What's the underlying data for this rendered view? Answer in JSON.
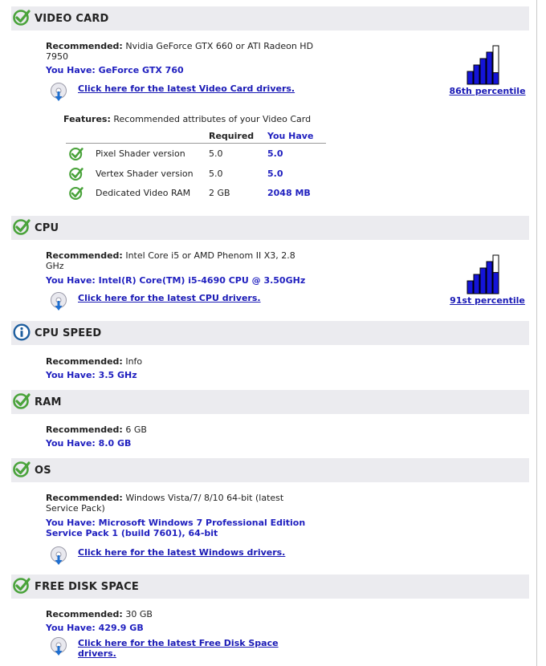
{
  "sections": {
    "video_card": {
      "title": "VIDEO CARD",
      "status_icon": "check-icon",
      "recommended_label": "Recommended:",
      "recommended_line1": "Nvidia GeForce GTX 660 or ATI Radeon HD",
      "recommended_line2": "7950",
      "you_have": "You Have: GeForce GTX 760",
      "driver_link": "Click here for the latest Video Card drivers.",
      "percentile_label": "86th percentile",
      "percentile_value": 86,
      "features_label": "Features:",
      "features_text": "Recommended attributes of your Video Card",
      "col_required": "Required",
      "col_you_have": "You Have",
      "features": [
        {
          "name": "Pixel Shader version",
          "required": "5.0",
          "have": "5.0"
        },
        {
          "name": "Vertex Shader version",
          "required": "5.0",
          "have": "5.0"
        },
        {
          "name": "Dedicated Video RAM",
          "required": "2 GB",
          "have": "2048 MB"
        }
      ]
    },
    "cpu": {
      "title": "CPU",
      "status_icon": "check-icon",
      "recommended_label": "Recommended:",
      "recommended_line1": "Intel Core i5 or AMD Phenom II X3, 2.8",
      "recommended_line2": "GHz",
      "you_have": "You Have: Intel(R) Core(TM) i5-4690 CPU @ 3.50GHz",
      "driver_link": "Click here for the latest CPU drivers.",
      "percentile_label": "91st percentile",
      "percentile_value": 91
    },
    "cpu_speed": {
      "title": "CPU SPEED",
      "status_icon": "info-icon",
      "recommended_label": "Recommended:",
      "recommended_line1": "Info",
      "you_have": "You Have: 3.5 GHz"
    },
    "ram": {
      "title": "RAM",
      "status_icon": "check-icon",
      "recommended_label": "Recommended:",
      "recommended_line1": "6 GB",
      "you_have": "You Have: 8.0 GB"
    },
    "os": {
      "title": "OS",
      "status_icon": "check-icon",
      "recommended_label": "Recommended:",
      "recommended_line1": "Windows Vista/7/ 8/10 64-bit (latest",
      "recommended_line2": "Service Pack)",
      "you_have_line1": "You Have: Microsoft Windows 7 Professional Edition",
      "you_have_line2": "Service Pack 1 (build 7601), 64-bit",
      "driver_link": "Click here for the latest Windows drivers."
    },
    "disk": {
      "title": "FREE DISK SPACE",
      "status_icon": "check-icon",
      "recommended_label": "Recommended:",
      "recommended_line1": "30 GB",
      "you_have": "You Have: 429.9 GB",
      "driver_link_line1": "Click here for the latest Free Disk Space",
      "driver_link_line2": "drivers."
    }
  },
  "colors": {
    "header_bg": "#ebebef",
    "check_green": "#4aa33b",
    "info_blue": "#1f5f9f",
    "link_blue": "#1a1ab5",
    "bar_blue": "#1414d8"
  }
}
